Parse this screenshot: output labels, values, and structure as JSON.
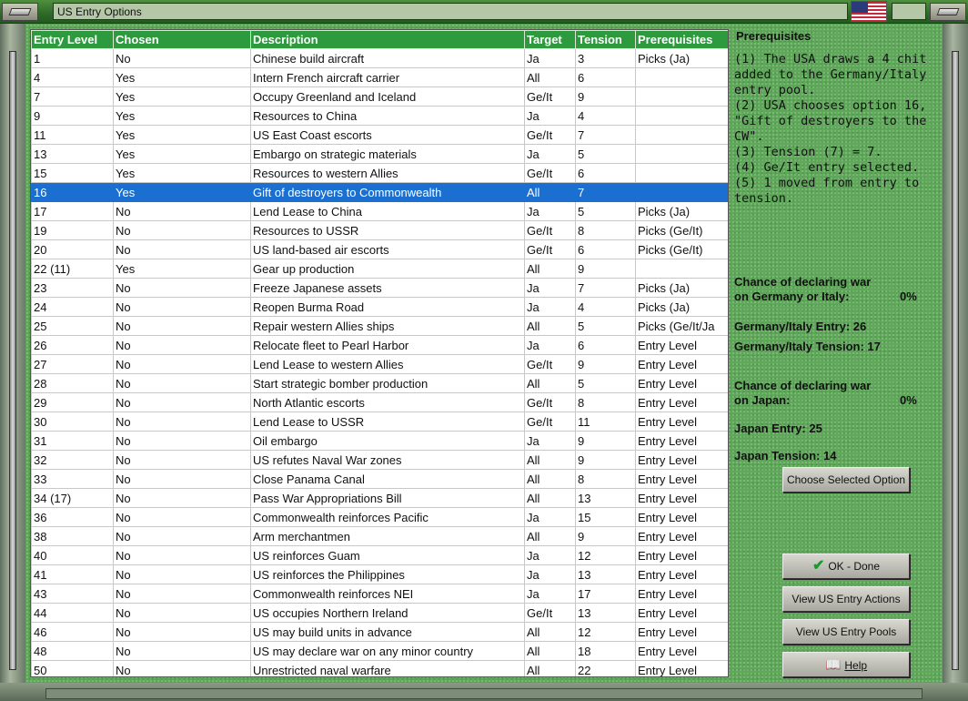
{
  "window": {
    "title": "US Entry Options"
  },
  "table": {
    "columns": [
      "Entry Level",
      "Chosen",
      "Description",
      "Target",
      "Tension",
      "Prerequisites"
    ],
    "rows": [
      [
        "1",
        "No",
        "Chinese build aircraft",
        "Ja",
        "3",
        "Picks (Ja)"
      ],
      [
        "4",
        "Yes",
        "Intern French aircraft carrier",
        "All",
        "6",
        ""
      ],
      [
        "7",
        "Yes",
        "Occupy Greenland and Iceland",
        "Ge/It",
        "9",
        ""
      ],
      [
        "9",
        "Yes",
        "Resources to China",
        "Ja",
        "4",
        ""
      ],
      [
        "11",
        "Yes",
        "US East Coast escorts",
        "Ge/It",
        "7",
        ""
      ],
      [
        "13",
        "Yes",
        "Embargo on strategic materials",
        "Ja",
        "5",
        ""
      ],
      [
        "15",
        "Yes",
        "Resources to western Allies",
        "Ge/It",
        "6",
        ""
      ],
      [
        "16",
        "Yes",
        "Gift of destroyers to Commonwealth",
        "All",
        "7",
        ""
      ],
      [
        "17",
        "No",
        "Lend Lease to China",
        "Ja",
        "5",
        "Picks (Ja)"
      ],
      [
        "19",
        "No",
        "Resources to USSR",
        "Ge/It",
        "8",
        "Picks (Ge/It)"
      ],
      [
        "20",
        "No",
        "US land-based air escorts",
        "Ge/It",
        "6",
        "Picks (Ge/It)"
      ],
      [
        "22 (11)",
        "Yes",
        "Gear up production",
        "All",
        "9",
        ""
      ],
      [
        "23",
        "No",
        "Freeze Japanese assets",
        "Ja",
        "7",
        "Picks (Ja)"
      ],
      [
        "24",
        "No",
        "Reopen Burma Road",
        "Ja",
        "4",
        "Picks (Ja)"
      ],
      [
        "25",
        "No",
        "Repair western Allies ships",
        "All",
        "5",
        "Picks (Ge/It/Ja"
      ],
      [
        "26",
        "No",
        "Relocate fleet to Pearl Harbor",
        "Ja",
        "6",
        "Entry Level"
      ],
      [
        "27",
        "No",
        "Lend Lease to western Allies",
        "Ge/It",
        "9",
        "Entry Level"
      ],
      [
        "28",
        "No",
        "Start strategic bomber production",
        "All",
        "5",
        "Entry Level"
      ],
      [
        "29",
        "No",
        "North Atlantic escorts",
        "Ge/It",
        "8",
        "Entry Level"
      ],
      [
        "30",
        "No",
        "Lend Lease to USSR",
        "Ge/It",
        "11",
        "Entry Level"
      ],
      [
        "31",
        "No",
        "Oil embargo",
        "Ja",
        "9",
        "Entry Level"
      ],
      [
        "32",
        "No",
        "US refutes Naval War zones",
        "All",
        "9",
        "Entry Level"
      ],
      [
        "33",
        "No",
        "Close Panama Canal",
        "All",
        "8",
        "Entry Level"
      ],
      [
        "34 (17)",
        "No",
        "Pass War Appropriations Bill",
        "All",
        "13",
        "Entry Level"
      ],
      [
        "36",
        "No",
        "Commonwealth reinforces Pacific",
        "Ja",
        "15",
        "Entry Level"
      ],
      [
        "38",
        "No",
        "Arm merchantmen",
        "All",
        "9",
        "Entry Level"
      ],
      [
        "40",
        "No",
        "US reinforces Guam",
        "Ja",
        "12",
        "Entry Level"
      ],
      [
        "41",
        "No",
        "US reinforces the Philippines",
        "Ja",
        "13",
        "Entry Level"
      ],
      [
        "43",
        "No",
        "Commonwealth reinforces NEI",
        "Ja",
        "17",
        "Entry Level"
      ],
      [
        "44",
        "No",
        "US occupies Northern Ireland",
        "Ge/It",
        "13",
        "Entry Level"
      ],
      [
        "46",
        "No",
        "US may build units in advance",
        "All",
        "12",
        "Entry Level"
      ],
      [
        "48",
        "No",
        "US may declare war on any minor country",
        "All",
        "18",
        "Entry Level"
      ],
      [
        "50",
        "No",
        "Unrestricted naval warfare",
        "All",
        "22",
        "Entry Level"
      ]
    ],
    "selected_entry": "16"
  },
  "panel": {
    "heading": "Prerequisites",
    "prereq_text": "(1) The USA draws a 4 chit\nadded to the Germany/Italy\nentry pool.\n(2) USA chooses option 16,\n\"Gift of destroyers to the\nCW\".\n(3) Tension (7) = 7.\n(4) Ge/It entry selected.\n(5) 1 moved from entry to\ntension.",
    "ge_chance_label_1": "Chance of declaring war",
    "ge_chance_label_2": "on Germany or Italy:",
    "ge_chance_value": "0%",
    "ge_entry": "Germany/Italy Entry: 26",
    "ge_tension": "Germany/Italy Tension: 17",
    "ja_chance_label_1": "Chance of declaring war",
    "ja_chance_label_2": "on Japan:",
    "ja_chance_value": "0%",
    "ja_entry": "Japan Entry: 25",
    "ja_tension": "Japan Tension: 14"
  },
  "buttons": {
    "choose": "Choose Selected Option",
    "ok": "OK - Done",
    "view_actions": "View US Entry Actions",
    "view_pools": "View US Entry Pools",
    "help": "Help"
  },
  "icons": {
    "ok": "checkmark-icon",
    "help": "book-icon"
  },
  "colors": {
    "header_green": "#2e9a3e",
    "selection_blue": "#1a6fd0",
    "background_green": "#5fa85a"
  }
}
